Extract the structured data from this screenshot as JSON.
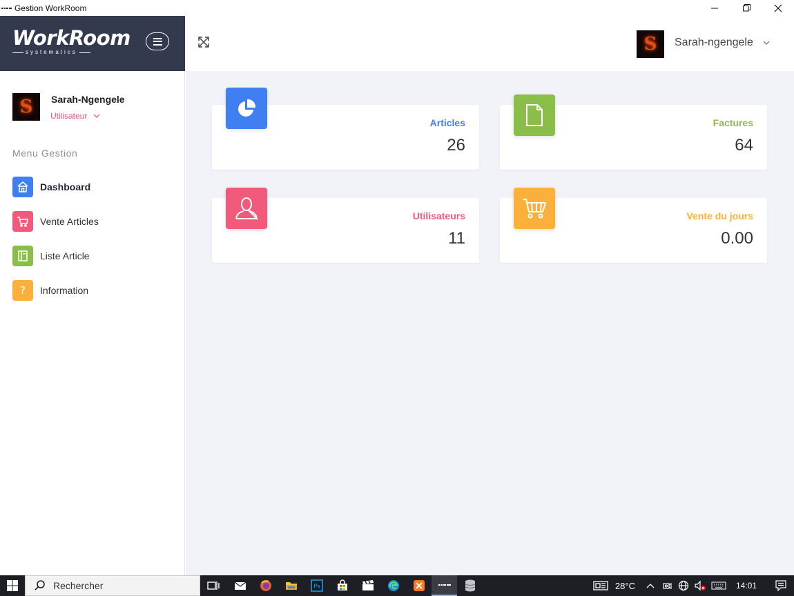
{
  "window": {
    "title": "Gestion WorkRoom"
  },
  "brand": {
    "logo_text": "WorkRoom",
    "logo_subtext": "systematics"
  },
  "header": {
    "user_name": "Sarah-ngengele",
    "avatar_letter": "S"
  },
  "sidebar": {
    "profile": {
      "name": "Sarah-Ngengele",
      "role": "Utilisateur",
      "avatar_letter": "S"
    },
    "menu_title": "Menu Gestion",
    "items": [
      {
        "label": "Dashboard",
        "icon": "home-icon",
        "color": "#3f7ff2",
        "active": true
      },
      {
        "label": "Vente Articles",
        "icon": "cart-icon",
        "color": "#f25a7b",
        "active": false
      },
      {
        "label": "Liste Article",
        "icon": "book-icon",
        "color": "#8bbd4a",
        "active": false
      },
      {
        "label": "Information",
        "icon": "question-icon",
        "color": "#fbb03b",
        "active": false
      }
    ]
  },
  "cards": [
    {
      "label": "Articles",
      "value": "26",
      "icon": "pie-chart-icon",
      "color": "#3f7ff2"
    },
    {
      "label": "Factures",
      "value": "64",
      "icon": "document-icon",
      "color": "#8bbd4a"
    },
    {
      "label": "Utilisateurs",
      "value": "11",
      "icon": "user-icon",
      "color": "#f25a7b"
    },
    {
      "label": "Vente du jours",
      "value": "0.00",
      "icon": "cart-icon",
      "color": "#fbb03b"
    }
  ],
  "taskbar": {
    "search_placeholder": "Rechercher",
    "temperature": "28°C",
    "time": "14:01"
  }
}
